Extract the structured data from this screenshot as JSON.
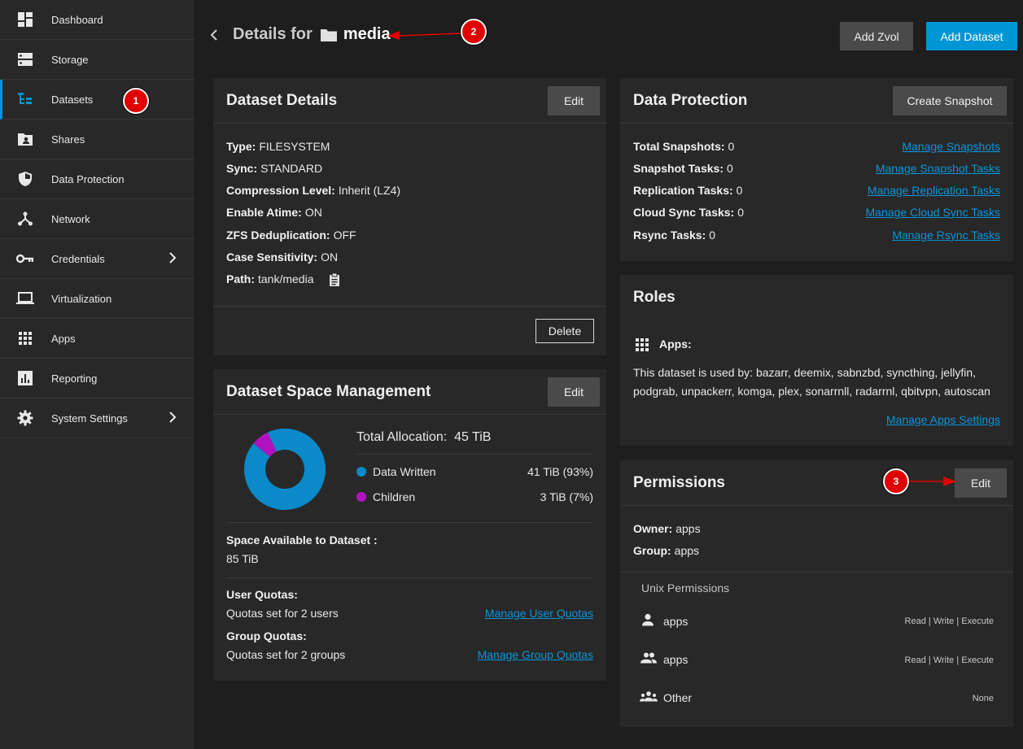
{
  "sidebar": {
    "items": [
      {
        "label": "Dashboard",
        "icon": "dashboard-icon"
      },
      {
        "label": "Storage",
        "icon": "storage-icon"
      },
      {
        "label": "Datasets",
        "icon": "datasets-icon"
      },
      {
        "label": "Shares",
        "icon": "shares-icon"
      },
      {
        "label": "Data Protection",
        "icon": "shield-icon"
      },
      {
        "label": "Network",
        "icon": "network-icon"
      },
      {
        "label": "Credentials",
        "icon": "key-icon"
      },
      {
        "label": "Virtualization",
        "icon": "laptop-icon"
      },
      {
        "label": "Apps",
        "icon": "apps-grid-icon"
      },
      {
        "label": "Reporting",
        "icon": "reporting-icon"
      },
      {
        "label": "System Settings",
        "icon": "gear-icon"
      }
    ]
  },
  "annotations": {
    "one": "1",
    "two": "2",
    "three": "3"
  },
  "header": {
    "title_prefix": "Details for",
    "dataset_name": "media",
    "add_zvol": "Add Zvol",
    "add_dataset": "Add Dataset"
  },
  "dataset_details": {
    "title": "Dataset Details",
    "edit": "Edit",
    "delete": "Delete",
    "fields": [
      {
        "label": "Type:",
        "value": "FILESYSTEM"
      },
      {
        "label": "Sync:",
        "value": "STANDARD"
      },
      {
        "label": "Compression Level:",
        "value": "Inherit (LZ4)"
      },
      {
        "label": "Enable Atime:",
        "value": "ON"
      },
      {
        "label": "ZFS Deduplication:",
        "value": "OFF"
      },
      {
        "label": "Case Sensitivity:",
        "value": "ON"
      },
      {
        "label": "Path:",
        "value": "tank/media"
      }
    ]
  },
  "space": {
    "title": "Dataset Space Management",
    "edit": "Edit",
    "total_label": "Total Allocation:",
    "total_value": "45 TiB",
    "legend": [
      {
        "label": "Data Written",
        "value": "41 TiB (93%)",
        "color": "#0a8ac8",
        "fraction": 0.93
      },
      {
        "label": "Children",
        "value": "3 TiB (7%)",
        "color": "#b012c0",
        "fraction": 0.07
      }
    ],
    "available_label": "Space Available to Dataset :",
    "available_value": "85 TiB",
    "user_quotas_label": "User Quotas:",
    "user_quotas_value": "Quotas set for 2 users",
    "user_quotas_link": "Manage User Quotas",
    "group_quotas_label": "Group Quotas:",
    "group_quotas_value": "Quotas set for 2 groups",
    "group_quotas_link": "Manage Group Quotas"
  },
  "protection": {
    "title": "Data Protection",
    "create_snapshot": "Create Snapshot",
    "rows": [
      {
        "label": "Total Snapshots:",
        "value": "0",
        "link": "Manage Snapshots"
      },
      {
        "label": "Snapshot Tasks:",
        "value": "0",
        "link": "Manage Snapshot Tasks"
      },
      {
        "label": "Replication Tasks:",
        "value": "0",
        "link": "Manage Replication Tasks"
      },
      {
        "label": "Cloud Sync Tasks:",
        "value": "0",
        "link": "Manage Cloud Sync Tasks"
      },
      {
        "label": "Rsync Tasks:",
        "value": "0",
        "link": "Manage Rsync Tasks"
      }
    ]
  },
  "roles": {
    "title": "Roles",
    "apps_label": "Apps:",
    "description_line1": "This dataset is used by: bazarr, deemix, sabnzbd, syncthing, jellyfin,",
    "description_line2": "podgrab, unpackerr, komga, plex, sonarrnll, radarrnl, qbitvpn, autoscan",
    "manage_link": "Manage Apps Settings"
  },
  "permissions": {
    "title": "Permissions",
    "edit": "Edit",
    "owner_label": "Owner:",
    "owner_value": "apps",
    "group_label": "Group:",
    "group_value": "apps",
    "unix_title": "Unix Permissions",
    "entries": [
      {
        "name": "apps",
        "perm": "Read | Write | Execute",
        "icon": "user-icon"
      },
      {
        "name": "apps",
        "perm": "Read | Write | Execute",
        "icon": "group-icon"
      },
      {
        "name": "Other",
        "perm": "None",
        "icon": "others-icon"
      }
    ]
  }
}
